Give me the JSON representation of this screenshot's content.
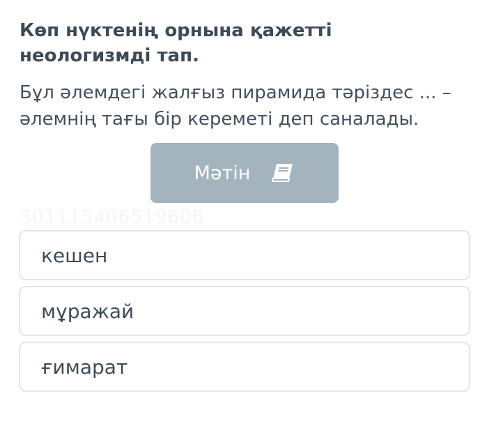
{
  "question": {
    "title": "Көп нүктенің орнына қажетті неологизмді тап.",
    "prompt": "Бұл әлемдегі жалғыз пирамида тәріздес ... – әлемнің тағы бір кереметі деп саналады."
  },
  "text_button": {
    "label": "Мәтін",
    "icon": "book-icon",
    "color": "#a3b4bf"
  },
  "watermark": "301115406519606",
  "options": [
    {
      "label": "кешен"
    },
    {
      "label": "мұражай"
    },
    {
      "label": "ғимарат"
    }
  ]
}
